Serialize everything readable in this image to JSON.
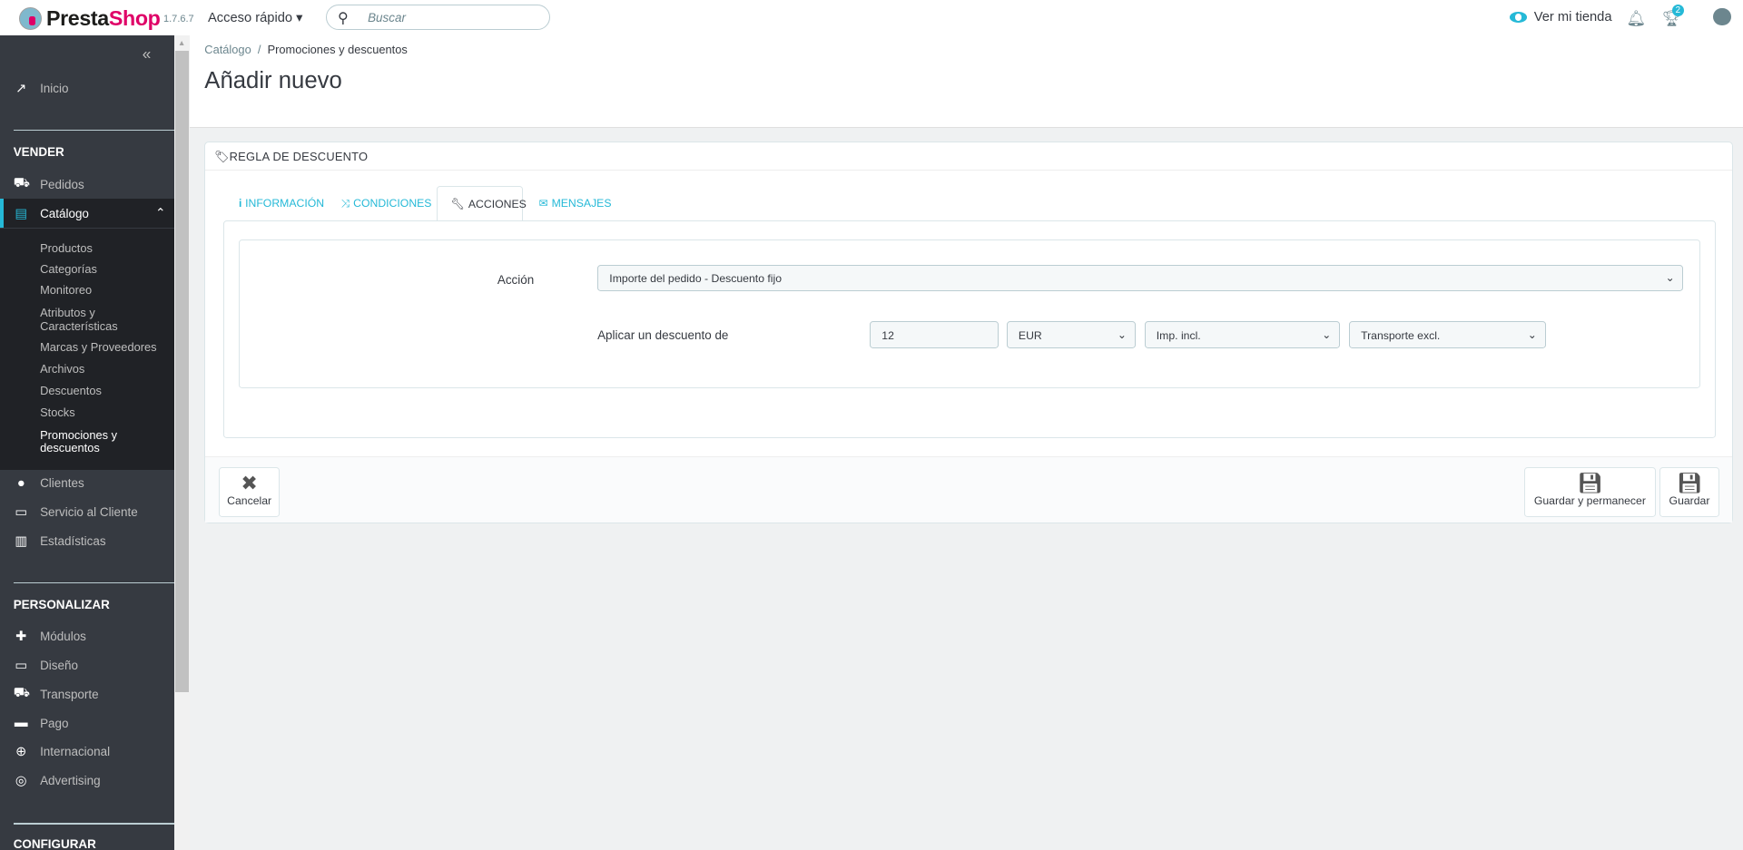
{
  "topbar": {
    "brand_a": "Presta",
    "brand_b": "Shop",
    "version": "1.7.6.7",
    "quick_access": "Acceso rápido",
    "search_placeholder": "Buscar",
    "view_shop": "Ver mi tienda",
    "notifications_count": "2"
  },
  "sidebar": {
    "home": "Inicio",
    "sell_title": "VENDER",
    "orders": "Pedidos",
    "catalog": "Catálogo",
    "catalog_sub": [
      "Productos",
      "Categorías",
      "Monitoreo",
      "Atributos y Características",
      "Marcas y Proveedores",
      "Archivos",
      "Descuentos",
      "Stocks",
      "Promociones y descuentos"
    ],
    "customers": "Clientes",
    "customer_service": "Servicio al Cliente",
    "stats": "Estadísticas",
    "customize_title": "PERSONALIZAR",
    "modules": "Módulos",
    "design": "Diseño",
    "shipping": "Transporte",
    "payment": "Pago",
    "international": "Internacional",
    "advertising": "Advertising",
    "configure_title": "CONFIGURAR"
  },
  "breadcrumb": {
    "parent": "Catálogo",
    "current": "Promociones y descuentos"
  },
  "page_title": "Añadir nuevo",
  "panel": {
    "title": "REGLA DE DESCUENTO",
    "tabs": [
      {
        "label": "INFORMACIÓN"
      },
      {
        "label": "CONDICIONES"
      },
      {
        "label": "ACCIONES"
      },
      {
        "label": "MENSAJES"
      }
    ],
    "action_label": "Acción",
    "action_value": "Importe del pedido - Descuento fijo",
    "discount_label": "Aplicar un descuento de",
    "amount": "12",
    "currency": "EUR",
    "tax": "Imp. incl.",
    "shipping": "Transporte excl.",
    "cancel": "Cancelar",
    "save_stay": "Guardar y permanecer",
    "save": "Guardar"
  }
}
